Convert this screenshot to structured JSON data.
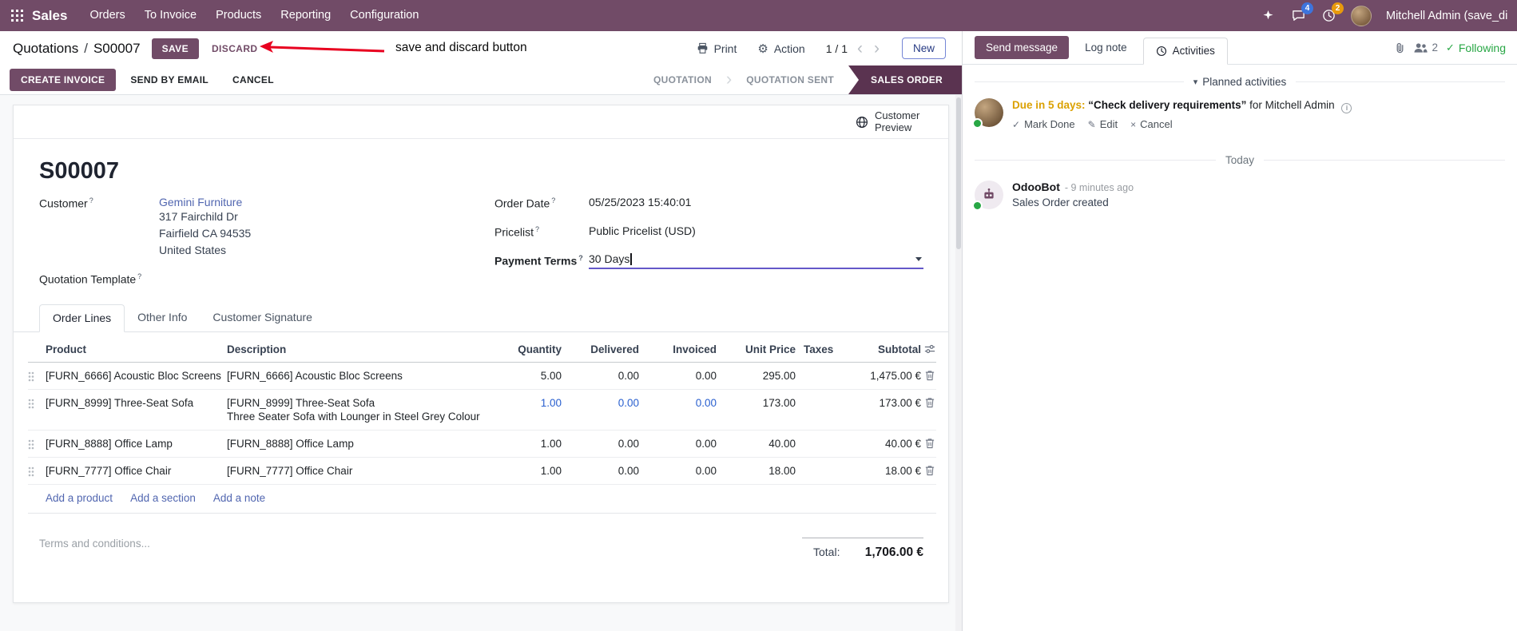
{
  "topbar": {
    "brand": "Sales",
    "menus": [
      "Orders",
      "To Invoice",
      "Products",
      "Reporting",
      "Configuration"
    ],
    "messages_badge": "4",
    "activities_badge": "2",
    "user": "Mitchell Admin (save_discar"
  },
  "control": {
    "breadcrumb_parent": "Quotations",
    "breadcrumb_sep": "/",
    "breadcrumb_current": "S00007",
    "save": "SAVE",
    "discard": "DISCARD",
    "print": "Print",
    "action": "Action",
    "pager": "1 / 1",
    "new": "New"
  },
  "annotation": {
    "text": "save and discard button"
  },
  "statusbar": {
    "create_invoice": "CREATE INVOICE",
    "send_by_email": "SEND BY EMAIL",
    "cancel": "CANCEL",
    "steps": [
      {
        "label": "QUOTATION",
        "active": false
      },
      {
        "label": "QUOTATION SENT",
        "active": false
      },
      {
        "label": "SALES ORDER",
        "active": true
      }
    ]
  },
  "sheet": {
    "help": "?",
    "preview_button": "Customer Preview",
    "title": "S00007",
    "fields": {
      "customer_label": "Customer",
      "customer_value": "Gemini Furniture",
      "address": [
        "317 Fairchild Dr",
        "Fairfield CA 94535",
        "United States"
      ],
      "quotation_template_label": "Quotation Template",
      "order_date_label": "Order Date",
      "order_date": "05/25/2023 15:40:01",
      "pricelist_label": "Pricelist",
      "pricelist": "Public Pricelist (USD)",
      "payment_terms_label": "Payment Terms",
      "payment_terms": "30 Days"
    },
    "tabs": [
      {
        "label": "Order Lines",
        "active": true
      },
      {
        "label": "Other Info",
        "active": false
      },
      {
        "label": "Customer Signature",
        "active": false
      }
    ],
    "table": {
      "headers": [
        "Product",
        "Description",
        "Quantity",
        "Delivered",
        "Invoiced",
        "Unit Price",
        "Taxes",
        "Subtotal"
      ],
      "rows": [
        {
          "product": "[FURN_6666] Acoustic Bloc Screens",
          "description": "[FURN_6666] Acoustic Bloc Screens",
          "description2": "",
          "quantity": "5.00",
          "delivered": "0.00",
          "invoiced": "0.00",
          "unit_price": "295.00",
          "taxes": "",
          "subtotal": "1,475.00 €",
          "changed": false
        },
        {
          "product": "[FURN_8999] Three-Seat Sofa",
          "description": "[FURN_8999] Three-Seat Sofa",
          "description2": "Three Seater Sofa with Lounger in Steel Grey Colour",
          "quantity": "1.00",
          "delivered": "0.00",
          "invoiced": "0.00",
          "unit_price": "173.00",
          "taxes": "",
          "subtotal": "173.00 €",
          "changed": true
        },
        {
          "product": "[FURN_8888] Office Lamp",
          "description": "[FURN_8888] Office Lamp",
          "description2": "",
          "quantity": "1.00",
          "delivered": "0.00",
          "invoiced": "0.00",
          "unit_price": "40.00",
          "taxes": "",
          "subtotal": "40.00 €",
          "changed": false
        },
        {
          "product": "[FURN_7777] Office Chair",
          "description": "[FURN_7777] Office Chair",
          "description2": "",
          "quantity": "1.00",
          "delivered": "0.00",
          "invoiced": "0.00",
          "unit_price": "18.00",
          "taxes": "",
          "subtotal": "18.00 €",
          "changed": false
        }
      ],
      "add_links": [
        "Add a product",
        "Add a section",
        "Add a note"
      ]
    },
    "terms_placeholder": "Terms and conditions...",
    "total_label": "Total:",
    "total_value": "1,706.00 €"
  },
  "chatter": {
    "send_message": "Send message",
    "log_note": "Log note",
    "activities": "Activities",
    "followers_count": "2",
    "following": "Following",
    "planned_header": "Planned activities",
    "activity": {
      "due": "Due in 5 days:",
      "title": "“Check delivery requirements”",
      "for_text": "for Mitchell Admin",
      "mark_done": "Mark Done",
      "edit": "Edit",
      "cancel": "Cancel"
    },
    "date_divider": "Today",
    "message": {
      "author": "OdooBot",
      "time": "- 9 minutes ago",
      "body": "Sales Order created"
    }
  }
}
